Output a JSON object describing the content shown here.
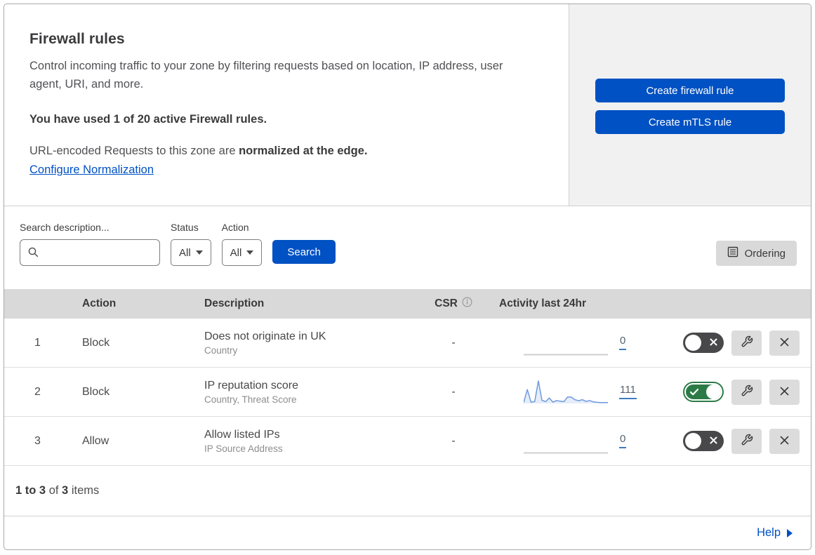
{
  "page": {
    "title": "Firewall rules",
    "description": "Control incoming traffic to your zone by filtering requests based on location, IP address, user agent, URI, and more.",
    "usage_notice": "You have used 1 of 20 active Firewall rules.",
    "normalization_text": "URL-encoded Requests to this zone are ",
    "normalization_bold": "normalized at the edge.",
    "normalization_link": "Configure Normalization"
  },
  "actions_panel": {
    "create_firewall_label": "Create firewall rule",
    "create_mtls_label": "Create mTLS rule"
  },
  "filters": {
    "search_label": "Search description...",
    "search_value": "",
    "status_label": "Status",
    "status_value": "All",
    "action_label": "Action",
    "action_value": "All",
    "search_button_label": "Search",
    "ordering_button_label": "Ordering"
  },
  "table": {
    "headers": {
      "action": "Action",
      "description": "Description",
      "csr": "CSR",
      "activity": "Activity last 24hr"
    },
    "rows": [
      {
        "priority": "1",
        "action": "Block",
        "description": "Does not originate in UK",
        "criteria": "Country",
        "csr": "-",
        "activity_count": "0",
        "enabled": false,
        "activity_values": []
      },
      {
        "priority": "2",
        "action": "Block",
        "description": "IP reputation score",
        "criteria": "Country, Threat Score",
        "csr": "-",
        "activity_count": "111",
        "enabled": true,
        "activity_values": [
          4,
          62,
          6,
          8,
          100,
          14,
          8,
          24,
          6,
          13,
          10,
          8,
          29,
          28,
          17,
          12,
          17,
          9,
          13,
          7,
          5,
          4,
          4,
          4
        ]
      },
      {
        "priority": "3",
        "action": "Allow",
        "description": "Allow listed IPs",
        "criteria": "IP Source Address",
        "csr": "-",
        "activity_count": "0",
        "enabled": false,
        "activity_values": []
      }
    ]
  },
  "footer": {
    "range": "1 to 3",
    "of_text": " of ",
    "total": "3",
    "items_text": " items"
  },
  "help": {
    "label": "Help"
  },
  "colors": {
    "accent_blue": "#0051c3",
    "toggle_on_green": "#2c7b47",
    "toggle_off_gray": "#48484b",
    "sparkline_blue": "#6f9add",
    "panel_gray": "#f1f1f1",
    "table_header_gray": "#d9d9d9"
  }
}
